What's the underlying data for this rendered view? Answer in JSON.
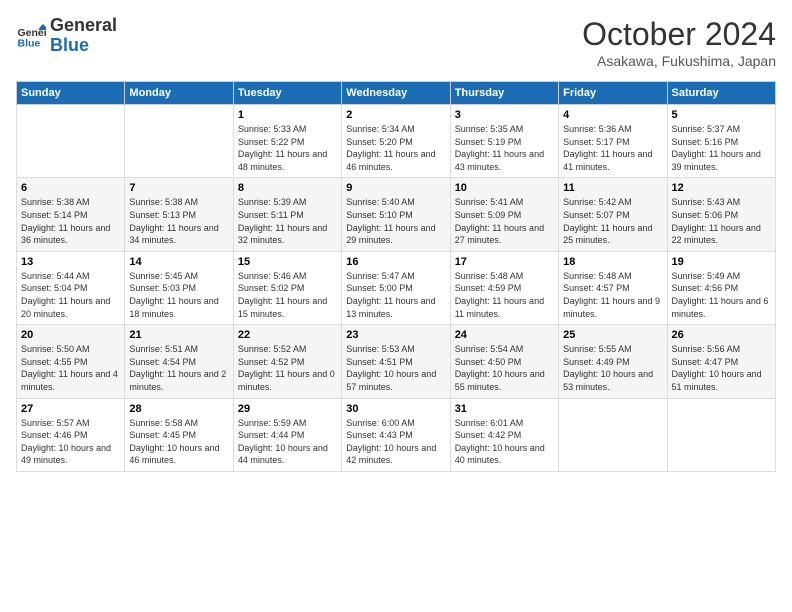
{
  "logo": {
    "line1": "General",
    "line2": "Blue"
  },
  "header": {
    "month": "October 2024",
    "location": "Asakawa, Fukushima, Japan"
  },
  "days_of_week": [
    "Sunday",
    "Monday",
    "Tuesday",
    "Wednesday",
    "Thursday",
    "Friday",
    "Saturday"
  ],
  "weeks": [
    [
      null,
      null,
      {
        "day": "1",
        "sunrise": "5:33 AM",
        "sunset": "5:22 PM",
        "daylight": "11 hours and 48 minutes."
      },
      {
        "day": "2",
        "sunrise": "5:34 AM",
        "sunset": "5:20 PM",
        "daylight": "11 hours and 46 minutes."
      },
      {
        "day": "3",
        "sunrise": "5:35 AM",
        "sunset": "5:19 PM",
        "daylight": "11 hours and 43 minutes."
      },
      {
        "day": "4",
        "sunrise": "5:36 AM",
        "sunset": "5:17 PM",
        "daylight": "11 hours and 41 minutes."
      },
      {
        "day": "5",
        "sunrise": "5:37 AM",
        "sunset": "5:16 PM",
        "daylight": "11 hours and 39 minutes."
      }
    ],
    [
      {
        "day": "6",
        "sunrise": "5:38 AM",
        "sunset": "5:14 PM",
        "daylight": "11 hours and 36 minutes."
      },
      {
        "day": "7",
        "sunrise": "5:38 AM",
        "sunset": "5:13 PM",
        "daylight": "11 hours and 34 minutes."
      },
      {
        "day": "8",
        "sunrise": "5:39 AM",
        "sunset": "5:11 PM",
        "daylight": "11 hours and 32 minutes."
      },
      {
        "day": "9",
        "sunrise": "5:40 AM",
        "sunset": "5:10 PM",
        "daylight": "11 hours and 29 minutes."
      },
      {
        "day": "10",
        "sunrise": "5:41 AM",
        "sunset": "5:09 PM",
        "daylight": "11 hours and 27 minutes."
      },
      {
        "day": "11",
        "sunrise": "5:42 AM",
        "sunset": "5:07 PM",
        "daylight": "11 hours and 25 minutes."
      },
      {
        "day": "12",
        "sunrise": "5:43 AM",
        "sunset": "5:06 PM",
        "daylight": "11 hours and 22 minutes."
      }
    ],
    [
      {
        "day": "13",
        "sunrise": "5:44 AM",
        "sunset": "5:04 PM",
        "daylight": "11 hours and 20 minutes."
      },
      {
        "day": "14",
        "sunrise": "5:45 AM",
        "sunset": "5:03 PM",
        "daylight": "11 hours and 18 minutes."
      },
      {
        "day": "15",
        "sunrise": "5:46 AM",
        "sunset": "5:02 PM",
        "daylight": "11 hours and 15 minutes."
      },
      {
        "day": "16",
        "sunrise": "5:47 AM",
        "sunset": "5:00 PM",
        "daylight": "11 hours and 13 minutes."
      },
      {
        "day": "17",
        "sunrise": "5:48 AM",
        "sunset": "4:59 PM",
        "daylight": "11 hours and 11 minutes."
      },
      {
        "day": "18",
        "sunrise": "5:48 AM",
        "sunset": "4:57 PM",
        "daylight": "11 hours and 9 minutes."
      },
      {
        "day": "19",
        "sunrise": "5:49 AM",
        "sunset": "4:56 PM",
        "daylight": "11 hours and 6 minutes."
      }
    ],
    [
      {
        "day": "20",
        "sunrise": "5:50 AM",
        "sunset": "4:55 PM",
        "daylight": "11 hours and 4 minutes."
      },
      {
        "day": "21",
        "sunrise": "5:51 AM",
        "sunset": "4:54 PM",
        "daylight": "11 hours and 2 minutes."
      },
      {
        "day": "22",
        "sunrise": "5:52 AM",
        "sunset": "4:52 PM",
        "daylight": "11 hours and 0 minutes."
      },
      {
        "day": "23",
        "sunrise": "5:53 AM",
        "sunset": "4:51 PM",
        "daylight": "10 hours and 57 minutes."
      },
      {
        "day": "24",
        "sunrise": "5:54 AM",
        "sunset": "4:50 PM",
        "daylight": "10 hours and 55 minutes."
      },
      {
        "day": "25",
        "sunrise": "5:55 AM",
        "sunset": "4:49 PM",
        "daylight": "10 hours and 53 minutes."
      },
      {
        "day": "26",
        "sunrise": "5:56 AM",
        "sunset": "4:47 PM",
        "daylight": "10 hours and 51 minutes."
      }
    ],
    [
      {
        "day": "27",
        "sunrise": "5:57 AM",
        "sunset": "4:46 PM",
        "daylight": "10 hours and 49 minutes."
      },
      {
        "day": "28",
        "sunrise": "5:58 AM",
        "sunset": "4:45 PM",
        "daylight": "10 hours and 46 minutes."
      },
      {
        "day": "29",
        "sunrise": "5:59 AM",
        "sunset": "4:44 PM",
        "daylight": "10 hours and 44 minutes."
      },
      {
        "day": "30",
        "sunrise": "6:00 AM",
        "sunset": "4:43 PM",
        "daylight": "10 hours and 42 minutes."
      },
      {
        "day": "31",
        "sunrise": "6:01 AM",
        "sunset": "4:42 PM",
        "daylight": "10 hours and 40 minutes."
      },
      null,
      null
    ]
  ]
}
